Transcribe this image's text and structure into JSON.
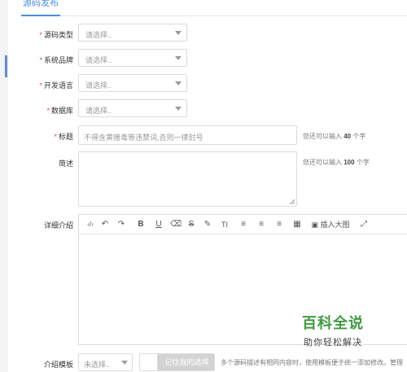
{
  "tabs": {
    "active": "源码发布"
  },
  "form": {
    "required_mark": "*",
    "source_type": {
      "label": "源码类型",
      "placeholder": "请选择.."
    },
    "brand": {
      "label": "系统品牌",
      "placeholder": "请选择.."
    },
    "language": {
      "label": "开发语言",
      "placeholder": "请选择.."
    },
    "database": {
      "label": "数据库",
      "placeholder": "请选择.."
    },
    "title": {
      "label": "标题",
      "placeholder": "不得含黄赌毒等违禁词,否则一律封号",
      "hint_prefix": "您还可以输入",
      "hint_count": "40",
      "hint_suffix": "个字"
    },
    "summary": {
      "label": "简述",
      "hint_prefix": "您还可以输入",
      "hint_count": "100",
      "hint_suffix": "个字"
    },
    "detail": {
      "label": "详细介绍"
    },
    "template": {
      "label": "介绍模板",
      "placeholder": "未选择..",
      "remember_label": "记住我的选择",
      "hint": "多个源码描述有相同内容时，使用模板便于统一添加修改。管理"
    }
  },
  "editor_toolbar": [
    {
      "name": "source-code-icon",
      "glyph": "‹/›"
    },
    {
      "name": "undo-icon",
      "glyph": "↶"
    },
    {
      "name": "redo-icon",
      "glyph": "↷"
    },
    {
      "name": "bold-icon",
      "glyph": "B"
    },
    {
      "name": "underline-icon",
      "glyph": "U"
    },
    {
      "name": "eraser-icon",
      "glyph": "⌫"
    },
    {
      "name": "strikethrough-icon",
      "glyph": "S"
    },
    {
      "name": "pen-icon",
      "glyph": "✎"
    },
    {
      "name": "font-size-icon",
      "glyph": "TI"
    },
    {
      "name": "align-left-icon",
      "glyph": "≡"
    },
    {
      "name": "align-center-icon",
      "glyph": "≡"
    },
    {
      "name": "align-right-icon",
      "glyph": "≡"
    },
    {
      "name": "table-icon",
      "glyph": "▦"
    },
    {
      "name": "fullscreen-icon",
      "glyph": "⤢"
    }
  ],
  "insert_image_label": "插入大图",
  "watermark": {
    "title": "百科全说",
    "subtitle": "助你轻松解决"
  },
  "colors": {
    "accent": "#4a8fe0",
    "required": "#e04a3a",
    "watermark": "#3f9a3f"
  }
}
